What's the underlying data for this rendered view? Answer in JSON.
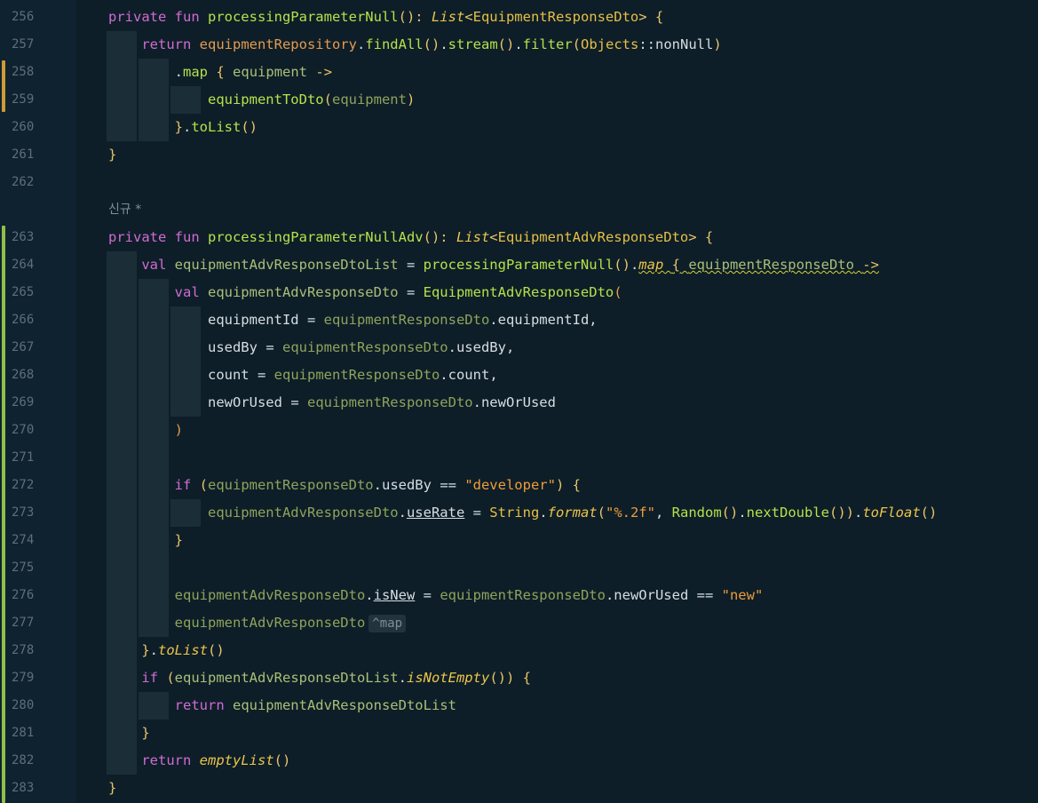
{
  "editor": {
    "line_numbers": [
      "256",
      "257",
      "258",
      "259",
      "260",
      "261",
      "262",
      "263",
      "264",
      "265",
      "266",
      "267",
      "268",
      "269",
      "270",
      "271",
      "272",
      "273",
      "274",
      "275",
      "276",
      "277",
      "278",
      "279",
      "280",
      "281",
      "282",
      "283"
    ],
    "author_hint": "신규 *",
    "inline_hint": "^map",
    "colors": {
      "background": "#0d1e28",
      "keyword": "#d16bd4",
      "function": "#b8e04a",
      "type": "#ecc44a",
      "string": "#f09c3a",
      "vcs_modified": "#d19a35",
      "vcs_added": "#8fbf4a"
    }
  }
}
